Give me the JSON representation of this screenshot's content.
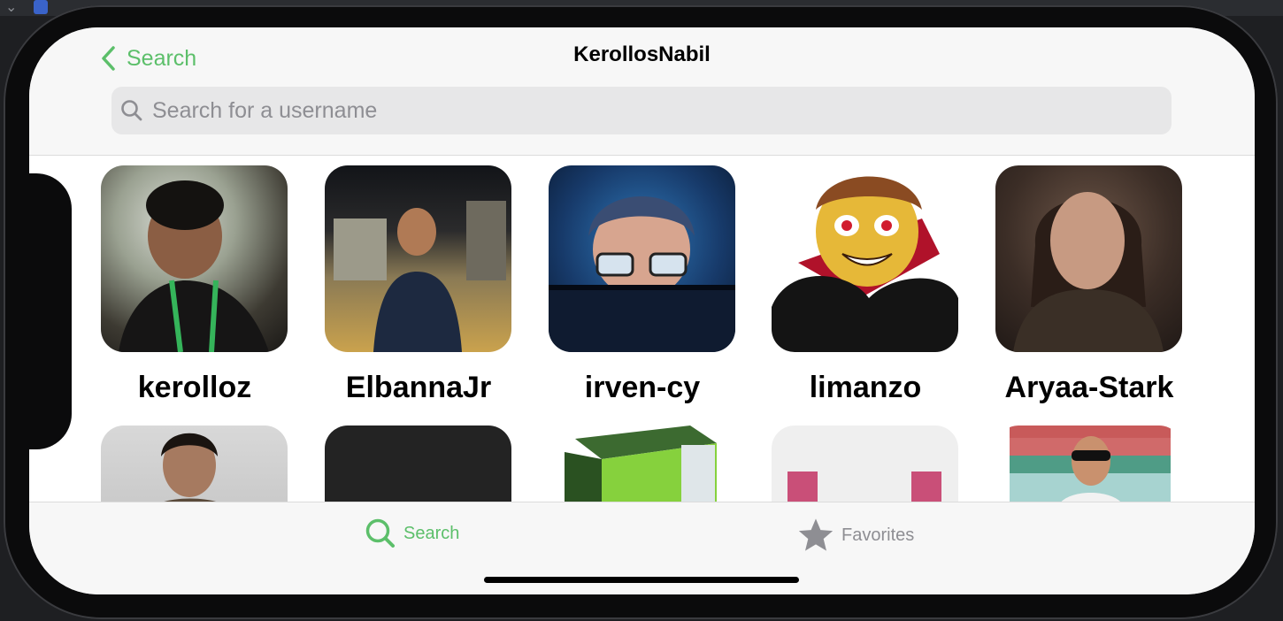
{
  "navbar": {
    "back_label": "Search",
    "title": "KerollosNabil"
  },
  "search": {
    "placeholder": "Search for a username",
    "value": ""
  },
  "grid": {
    "row1": [
      {
        "username": "kerolloz"
      },
      {
        "username": "ElbannaJr"
      },
      {
        "username": "irven-cy"
      },
      {
        "username": "limanzo"
      },
      {
        "username": "Aryaa-Stark"
      }
    ]
  },
  "tabbar": {
    "tabs": [
      {
        "label": "Search",
        "icon": "magnifier-icon",
        "selected": true
      },
      {
        "label": "Favorites",
        "icon": "star-icon",
        "selected": false
      }
    ]
  },
  "colors": {
    "accent": "#5cbf6a",
    "inactive": "#8e8e93"
  }
}
